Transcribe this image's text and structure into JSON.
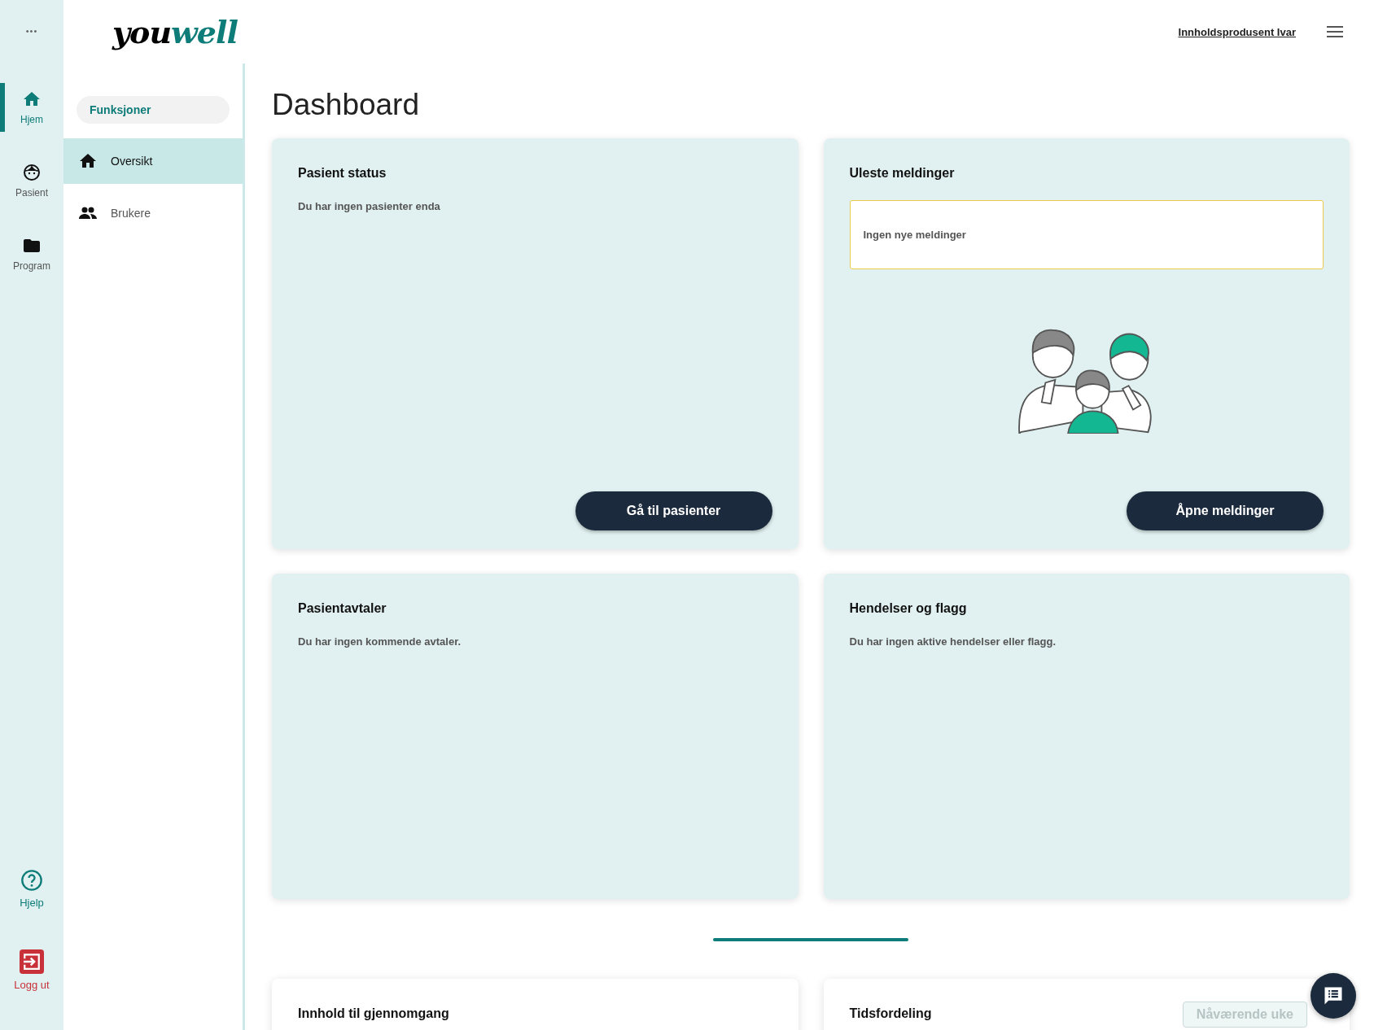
{
  "rail": {
    "more": "•••",
    "items": [
      {
        "label": "Hjem",
        "kind": "home",
        "selected": true
      },
      {
        "label": "Pasient",
        "kind": "face",
        "selected": false
      },
      {
        "label": "Program",
        "kind": "folder",
        "selected": false
      }
    ],
    "bottom": [
      {
        "label": "Hjelp",
        "kind": "help"
      },
      {
        "label": "Logg ut",
        "kind": "logout"
      }
    ]
  },
  "logo": {
    "dark": "you",
    "accent": "well"
  },
  "header": {
    "user": "Innholdsprodusent Ivar"
  },
  "sidebar": {
    "section": "Funksjoner",
    "items": [
      {
        "label": "Oversikt",
        "kind": "home",
        "selected": true
      },
      {
        "label": "Brukere",
        "kind": "people",
        "selected": false
      }
    ]
  },
  "page_title": "Dashboard",
  "cards": [
    {
      "kind": "status",
      "title": "Pasient status",
      "text": "Du har ingen pasienter enda",
      "button": "Gå til pasienter"
    },
    {
      "kind": "messages",
      "title": "Uleste meldinger",
      "notice": "Ingen nye meldinger",
      "button": "Åpne meldinger"
    },
    {
      "kind": "status",
      "title": "Pasientavtaler",
      "text": "Du har ingen kommende avtaler."
    },
    {
      "kind": "status",
      "title": "Hendelser og flagg",
      "text": "Du har ingen aktive hendelser eller flagg."
    }
  ],
  "lower_cards": [
    {
      "title": "Innhold til gjennomgang"
    },
    {
      "title": "Tidsfordeling",
      "button": {
        "label": "Nåværende uke",
        "disabled": true
      }
    }
  ]
}
